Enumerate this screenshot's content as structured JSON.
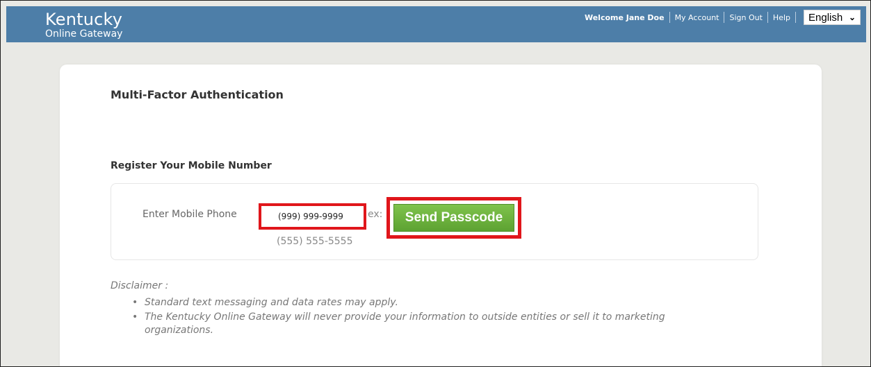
{
  "header": {
    "brand_title": "Kentucky",
    "brand_subtitle": "Online Gateway",
    "welcome": "Welcome Jane Doe",
    "my_account": "My Account",
    "sign_out": "Sign Out",
    "help": "Help",
    "language_selected": "English",
    "bar_color": "#4d7ea8"
  },
  "card": {
    "title": "Multi-Factor Authentication",
    "register_title": "Register Your Mobile Number",
    "phone_label": "Enter Mobile Phone",
    "phone_value": "(999) 999-9999",
    "example_prefix": "ex:",
    "example_number": "(555) 555-5555",
    "send_button": "Send Passcode",
    "highlight_color": "#e0161b",
    "button_color": "#6cb33e"
  },
  "disclaimer": {
    "title": "Disclaimer :",
    "items": [
      "Standard text messaging and data rates may apply.",
      "The Kentucky Online Gateway will never provide your information to outside entities or sell it to marketing organizations."
    ]
  }
}
